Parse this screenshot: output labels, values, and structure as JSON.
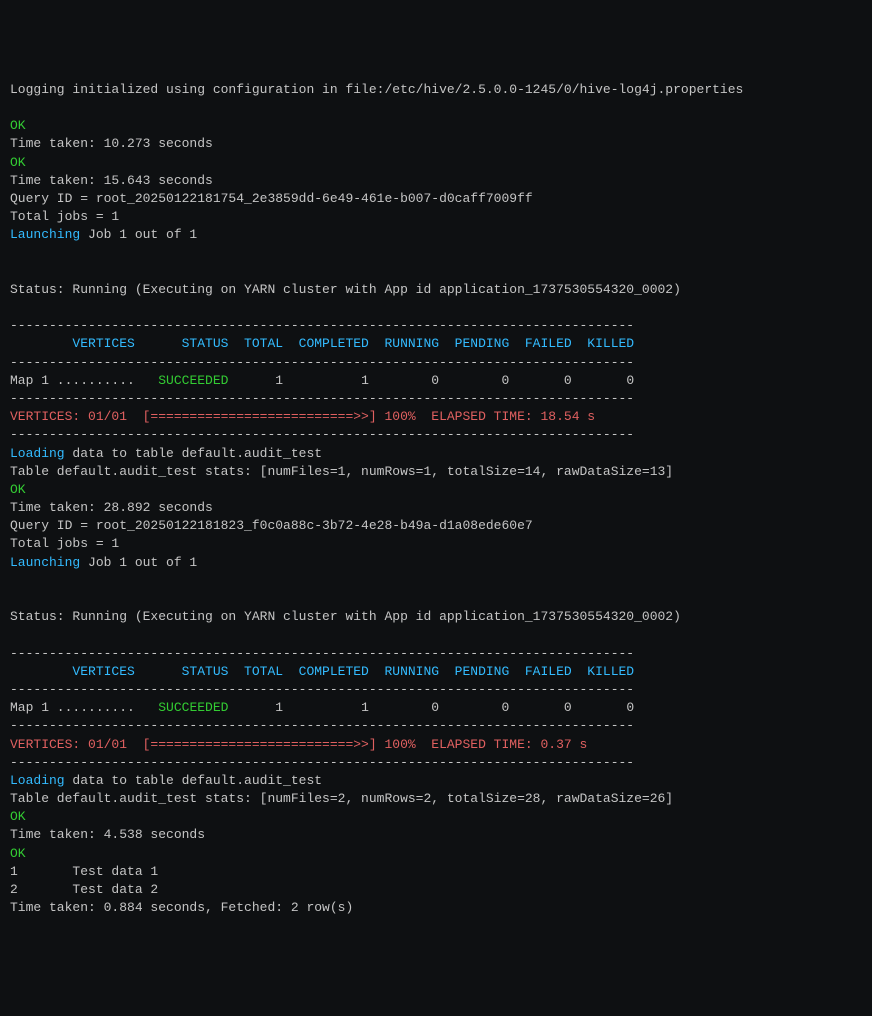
{
  "lines": [
    {
      "segments": [
        {
          "t": "grey",
          "v": "Logging initialized using configuration in file:/etc/hive/2.5.0.0-1245/0/hive-log4j.properties"
        }
      ]
    },
    {
      "segments": [
        {
          "t": "grey",
          "v": " "
        }
      ]
    },
    {
      "segments": [
        {
          "t": "green",
          "v": "OK"
        }
      ]
    },
    {
      "segments": [
        {
          "t": "grey",
          "v": "Time taken: 10.273 seconds"
        }
      ]
    },
    {
      "segments": [
        {
          "t": "green",
          "v": "OK"
        }
      ]
    },
    {
      "segments": [
        {
          "t": "grey",
          "v": "Time taken: 15.643 seconds"
        }
      ]
    },
    {
      "segments": [
        {
          "t": "grey",
          "v": "Query ID = root_20250122181754_2e3859dd-6e49-461e-b007-d0caff7009ff"
        }
      ]
    },
    {
      "segments": [
        {
          "t": "grey",
          "v": "Total jobs = 1"
        }
      ]
    },
    {
      "segments": [
        {
          "t": "cyan",
          "v": "Launching"
        },
        {
          "t": "grey",
          "v": " Job 1 out of 1"
        }
      ]
    },
    {
      "segments": [
        {
          "t": "grey",
          "v": " "
        }
      ]
    },
    {
      "segments": [
        {
          "t": "grey",
          "v": " "
        }
      ]
    },
    {
      "segments": [
        {
          "t": "grey",
          "v": "Status: Running (Executing on YARN cluster with App id application_1737530554320_0002)"
        }
      ]
    },
    {
      "segments": [
        {
          "t": "grey",
          "v": " "
        }
      ]
    },
    {
      "segments": [
        {
          "t": "grey",
          "v": "--------------------------------------------------------------------------------"
        }
      ]
    },
    {
      "segments": [
        {
          "t": "cyan",
          "v": "        VERTICES      STATUS  TOTAL  COMPLETED  RUNNING  PENDING  FAILED  KILLED"
        }
      ]
    },
    {
      "segments": [
        {
          "t": "grey",
          "v": "--------------------------------------------------------------------------------"
        }
      ]
    },
    {
      "segments": [
        {
          "t": "grey",
          "v": "Map 1 ..........   "
        },
        {
          "t": "green",
          "v": "SUCCEEDED"
        },
        {
          "t": "grey",
          "v": "      1          1        0        0       0       0"
        }
      ]
    },
    {
      "segments": [
        {
          "t": "grey",
          "v": "--------------------------------------------------------------------------------"
        }
      ]
    },
    {
      "segments": [
        {
          "t": "red",
          "v": "VERTICES: 01/01  [==========================>>] 100%  ELAPSED TIME: 18.54 s   "
        }
      ]
    },
    {
      "segments": [
        {
          "t": "grey",
          "v": "--------------------------------------------------------------------------------"
        }
      ]
    },
    {
      "segments": [
        {
          "t": "cyan",
          "v": "Loading"
        },
        {
          "t": "grey",
          "v": " data to table default.audit_test"
        }
      ]
    },
    {
      "segments": [
        {
          "t": "grey",
          "v": "Table default.audit_test stats: [numFiles=1, numRows=1, totalSize=14, rawDataSize=13]"
        }
      ]
    },
    {
      "segments": [
        {
          "t": "green",
          "v": "OK"
        }
      ]
    },
    {
      "segments": [
        {
          "t": "grey",
          "v": "Time taken: 28.892 seconds"
        }
      ]
    },
    {
      "segments": [
        {
          "t": "grey",
          "v": "Query ID = root_20250122181823_f0c0a88c-3b72-4e28-b49a-d1a08ede60e7"
        }
      ]
    },
    {
      "segments": [
        {
          "t": "grey",
          "v": "Total jobs = 1"
        }
      ]
    },
    {
      "segments": [
        {
          "t": "cyan",
          "v": "Launching"
        },
        {
          "t": "grey",
          "v": " Job 1 out of 1"
        }
      ]
    },
    {
      "segments": [
        {
          "t": "grey",
          "v": " "
        }
      ]
    },
    {
      "segments": [
        {
          "t": "grey",
          "v": " "
        }
      ]
    },
    {
      "segments": [
        {
          "t": "grey",
          "v": "Status: Running (Executing on YARN cluster with App id application_1737530554320_0002)"
        }
      ]
    },
    {
      "segments": [
        {
          "t": "grey",
          "v": " "
        }
      ]
    },
    {
      "segments": [
        {
          "t": "grey",
          "v": "--------------------------------------------------------------------------------"
        }
      ]
    },
    {
      "segments": [
        {
          "t": "cyan",
          "v": "        VERTICES      STATUS  TOTAL  COMPLETED  RUNNING  PENDING  FAILED  KILLED"
        }
      ]
    },
    {
      "segments": [
        {
          "t": "grey",
          "v": "--------------------------------------------------------------------------------"
        }
      ]
    },
    {
      "segments": [
        {
          "t": "grey",
          "v": "Map 1 ..........   "
        },
        {
          "t": "green",
          "v": "SUCCEEDED"
        },
        {
          "t": "grey",
          "v": "      1          1        0        0       0       0"
        }
      ]
    },
    {
      "segments": [
        {
          "t": "grey",
          "v": "--------------------------------------------------------------------------------"
        }
      ]
    },
    {
      "segments": [
        {
          "t": "red",
          "v": "VERTICES: 01/01  [==========================>>] 100%  ELAPSED TIME: 0.37 s    "
        }
      ]
    },
    {
      "segments": [
        {
          "t": "grey",
          "v": "--------------------------------------------------------------------------------"
        }
      ]
    },
    {
      "segments": [
        {
          "t": "cyan",
          "v": "Loading"
        },
        {
          "t": "grey",
          "v": " data to table default.audit_test"
        }
      ]
    },
    {
      "segments": [
        {
          "t": "grey",
          "v": "Table default.audit_test stats: [numFiles=2, numRows=2, totalSize=28, rawDataSize=26]"
        }
      ]
    },
    {
      "segments": [
        {
          "t": "green",
          "v": "OK"
        }
      ]
    },
    {
      "segments": [
        {
          "t": "grey",
          "v": "Time taken: 4.538 seconds"
        }
      ]
    },
    {
      "segments": [
        {
          "t": "green",
          "v": "OK"
        }
      ]
    },
    {
      "segments": [
        {
          "t": "grey",
          "v": "1       Test data 1"
        }
      ]
    },
    {
      "segments": [
        {
          "t": "grey",
          "v": "2       Test data 2"
        }
      ]
    },
    {
      "segments": [
        {
          "t": "grey",
          "v": "Time taken: 0.884 seconds, Fetched: 2 row(s)"
        }
      ]
    }
  ]
}
